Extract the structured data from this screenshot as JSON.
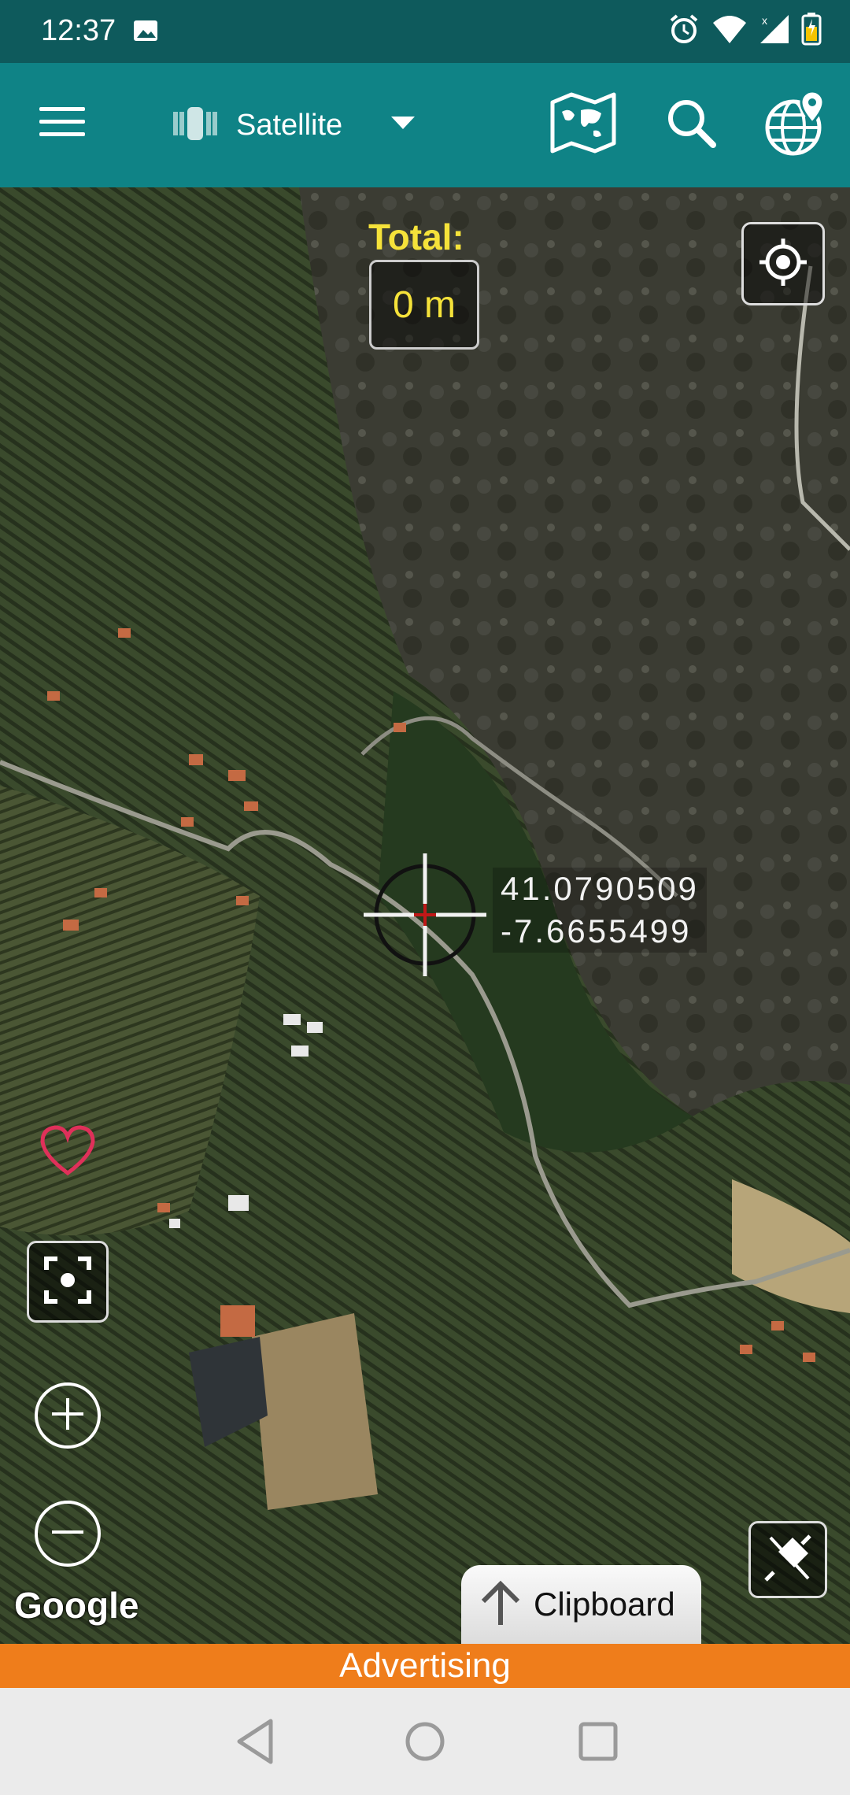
{
  "status_bar": {
    "time": "12:37"
  },
  "toolbar": {
    "map_type_label": "Satellite"
  },
  "map": {
    "total_label": "Total:",
    "total_value": "0 m",
    "latitude": "41.0790509",
    "longitude": "-7.6655499",
    "attribution": "Google",
    "clipboard_label": "Clipboard"
  },
  "ad_bar": {
    "label": "Advertising"
  },
  "colors": {
    "status_bar": "#0e5a5c",
    "toolbar": "#0f8386",
    "accent_yellow": "#f5e23a",
    "ad_orange": "#ef7d1b",
    "heart": "#e0305a"
  },
  "icons": [
    "image-icon",
    "alarm-icon",
    "wifi-icon",
    "signal-icon",
    "battery-icon",
    "menu-icon",
    "satellite-icon",
    "chevron-down-icon",
    "world-map-icon",
    "search-icon",
    "globe-pin-icon",
    "my-location-icon",
    "crosshair-icon",
    "heart-icon",
    "fullscreen-icon",
    "zoom-in-icon",
    "zoom-out-icon",
    "gps-off-icon",
    "arrow-up-icon",
    "back-icon",
    "home-icon",
    "recents-icon"
  ]
}
